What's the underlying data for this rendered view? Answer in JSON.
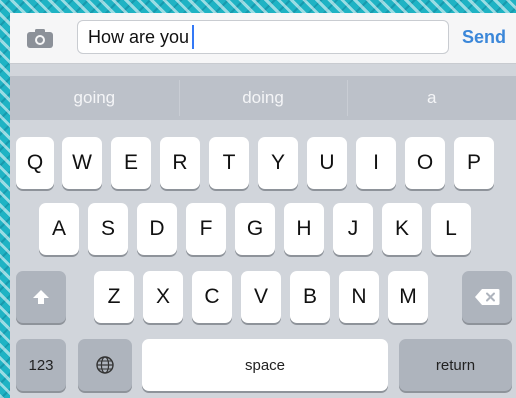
{
  "composer": {
    "camera_icon": "camera-icon",
    "message_text": "How are you",
    "send_label": "Send"
  },
  "suggestions": [
    "going",
    "doing",
    "a"
  ],
  "keyboard": {
    "row1": [
      "Q",
      "W",
      "E",
      "R",
      "T",
      "Y",
      "U",
      "I",
      "O",
      "P"
    ],
    "row2": [
      "A",
      "S",
      "D",
      "F",
      "G",
      "H",
      "J",
      "K",
      "L"
    ],
    "row3": [
      "Z",
      "X",
      "C",
      "V",
      "B",
      "N",
      "M"
    ],
    "shift_icon": "shift-icon",
    "delete_icon": "delete-icon",
    "numbers_label": "123",
    "globe_icon": "globe-icon",
    "space_label": "space",
    "return_label": "return"
  },
  "colors": {
    "send": "#3b87d9",
    "caret": "#3479f6",
    "key": "#ffffff",
    "dark_key": "#aeb4bd",
    "keyboard_bg": "#d1d5db"
  }
}
